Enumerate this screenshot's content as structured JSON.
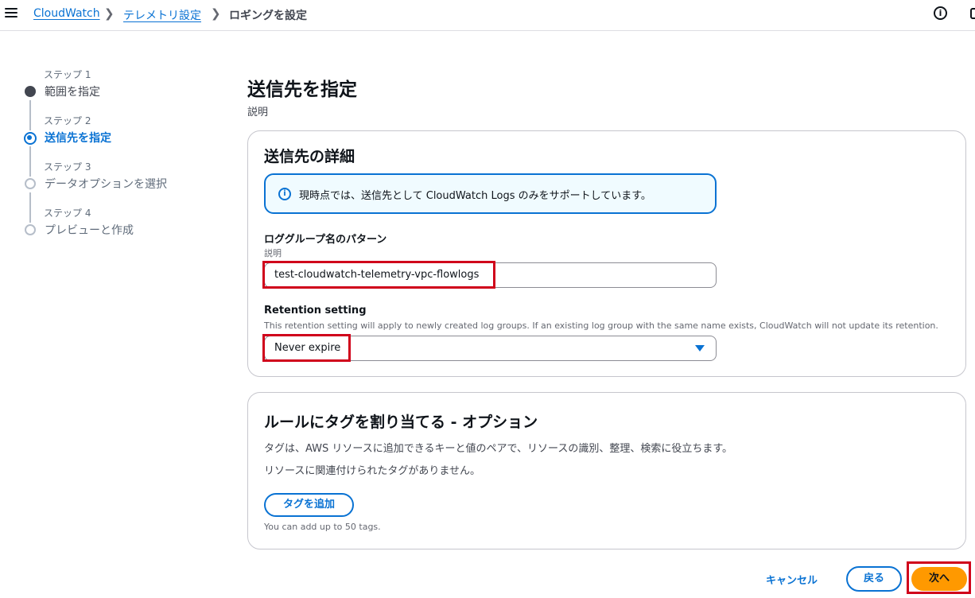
{
  "breadcrumb": {
    "items": [
      "CloudWatch",
      "テレメトリ設定"
    ],
    "current": "ロギングを設定"
  },
  "steps": [
    {
      "caption": "ステップ 1",
      "label": "範囲を指定",
      "state": "done"
    },
    {
      "caption": "ステップ 2",
      "label": "送信先を指定",
      "state": "active"
    },
    {
      "caption": "ステップ 3",
      "label": "データオプションを選択",
      "state": "pending"
    },
    {
      "caption": "ステップ 4",
      "label": "プレビューと作成",
      "state": "pending"
    }
  ],
  "page": {
    "title": "送信先を指定",
    "description": "説明"
  },
  "destination": {
    "title": "送信先の詳細",
    "alert": "現時点では、送信先として CloudWatch Logs のみをサポートしています。",
    "log_group": {
      "label": "ロググループ名のパターン",
      "description": "説明",
      "value": "test-cloudwatch-telemetry-vpc-flowlogs"
    },
    "retention": {
      "label": "Retention setting",
      "description": "This retention setting will apply to newly created log groups. If an existing log group with the same name exists, CloudWatch will not update its retention.",
      "selected": "Never expire"
    }
  },
  "tags": {
    "title": "ルールにタグを割り当てる - オプション",
    "description": "タグは、AWS リソースに追加できるキーと値のペアで、リソースの識別、整理、検索に役立ちます。",
    "empty": "リソースに関連付けられたタグがありません。",
    "add_button": "タグを追加",
    "limit_note": "You can add up to 50 tags."
  },
  "footer": {
    "cancel": "キャンセル",
    "back": "戻る",
    "next": "次へ"
  },
  "colors": {
    "accent": "#0972d3",
    "primary_button": "#ff9900",
    "highlight": "#d0021b"
  }
}
